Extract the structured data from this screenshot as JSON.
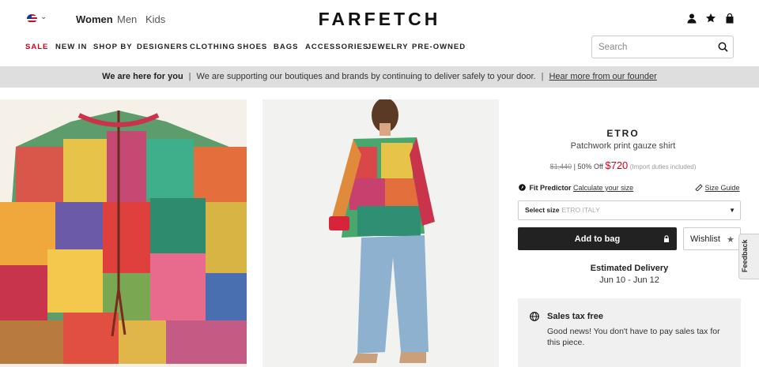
{
  "header": {
    "country_icon": "us-flag-icon",
    "genders": [
      "Women",
      "Men",
      "Kids"
    ],
    "active_gender": "Women",
    "logo": "FARFETCH",
    "icons": [
      "account-icon",
      "wishlist-star-icon",
      "bag-icon"
    ]
  },
  "nav": {
    "items": [
      "SALE",
      "NEW IN",
      "SHOP BY",
      "DESIGNERS",
      "CLOTHING",
      "SHOES",
      "BAGS",
      "ACCESSORIES",
      "JEWELRY",
      "PRE-OWNED"
    ],
    "sale_color": "#d0021b"
  },
  "search": {
    "placeholder": "Search",
    "value": ""
  },
  "banner": {
    "bold": "We are here for you",
    "text": "We are supporting our boutiques and brands by continuing to deliver safely to your door.",
    "link": "Hear more from our founder"
  },
  "product": {
    "brand": "ETRO",
    "name": "Patchwork print gauze shirt",
    "old_price": "$1,440",
    "discount": "| 50% Off",
    "price": "$720",
    "duties": "(Import duties included)",
    "fit_predictor_label": "Fit Predictor",
    "fit_link": "Calculate your size",
    "size_guide": "Size Guide",
    "size_select_label": "Select size",
    "size_select_hint": "ETRO ITALY",
    "add_to_bag": "Add to bag",
    "wishlist": "Wishlist",
    "delivery_title": "Estimated Delivery",
    "delivery_dates": "Jun 10 - Jun 12",
    "tax_title": "Sales tax free",
    "tax_text": "Good news! You don't have to pay sales tax for this piece."
  },
  "feedback_tab": "Feedback",
  "colors": {
    "accent_red": "#d0021b",
    "button_dark": "#222222",
    "banner_bg": "#dedede"
  }
}
